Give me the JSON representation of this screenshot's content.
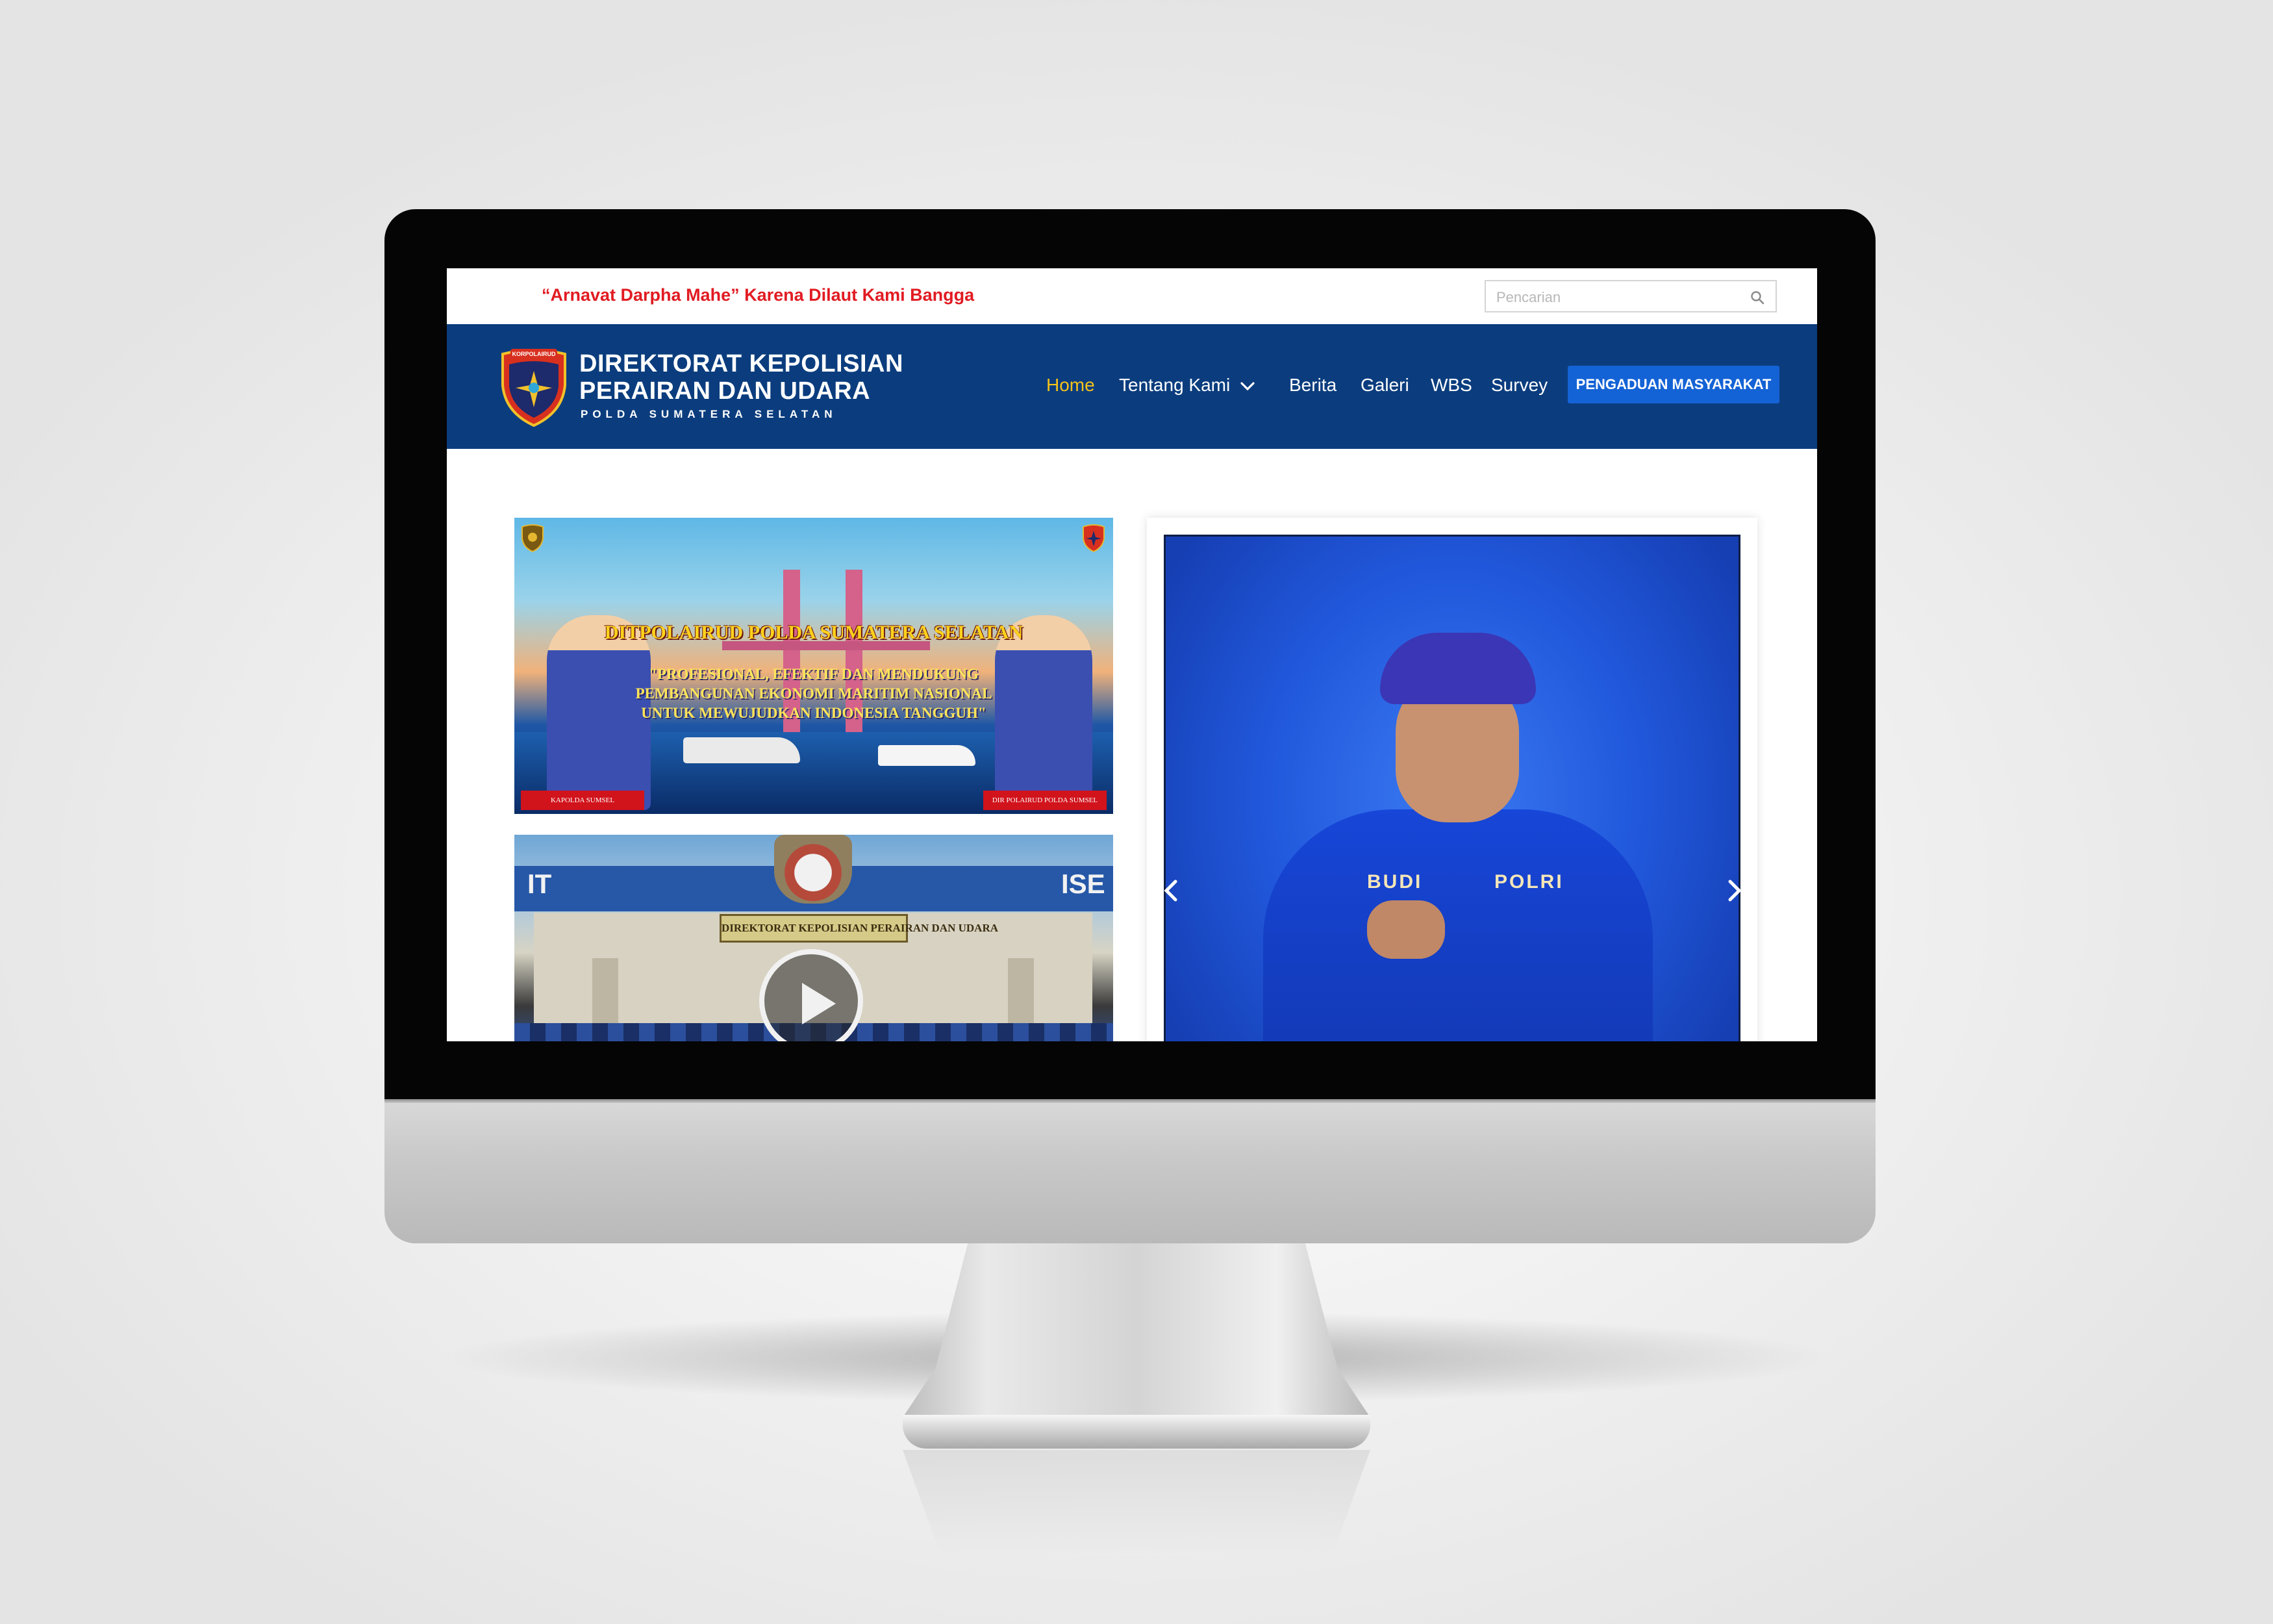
{
  "topbar": {
    "tagline": "“Arnavat Darpha Mahe” Karena Dilaut Kami Bangga",
    "search": {
      "placeholder": "Pencarian",
      "value": ""
    }
  },
  "header": {
    "brand": {
      "line1": "DIREKTORAT KEPOLISIAN",
      "line2": "PERAIRAN DAN UDARA",
      "sub": "POLDA SUMATERA SELATAN",
      "logo_text": "KORPOLAIRUD"
    },
    "nav": {
      "items": [
        {
          "label": "Home",
          "active": true
        },
        {
          "label": "Tentang Kami",
          "has_dropdown": true
        },
        {
          "label": "Berita"
        },
        {
          "label": "Galeri"
        },
        {
          "label": "WBS"
        },
        {
          "label": "Survey"
        }
      ],
      "cta_label": "PENGADUAN MASYARAKAT"
    }
  },
  "main": {
    "banner": {
      "title": "DITPOLAIRUD POLDA SUMATERA SELATAN",
      "slogan_lines": [
        "\"PROFESIONAL, EFEKTIF DAN MENDUKUNG",
        "PEMBANGUNAN EKONOMI MARITIM NASIONAL",
        "UNTUK MEWUJUDKAN INDONESIA TANGGUH\""
      ],
      "caption_left": "KAPOLDA SUMSEL",
      "caption_right": "DIR POLAIRUD POLDA SUMSEL"
    },
    "video": {
      "sign_text": "DIREKTORAT KEPOLISIAN PERAIRAN DAN UDARA",
      "roof_text_left": "IT",
      "roof_text_right": "ISE"
    },
    "slider": {
      "name_tag": "BUDI",
      "unit_tag": "POLRI"
    }
  },
  "colors": {
    "navbar": "#0b3d7e",
    "active_nav": "#f6c21a",
    "cta": "#1463d6",
    "tagline": "#e11b22"
  },
  "icons": {
    "search": "search-icon",
    "dropdown": "chevron-down-icon",
    "play": "play-icon",
    "prev": "chevron-left-icon",
    "next": "chevron-right-icon"
  }
}
